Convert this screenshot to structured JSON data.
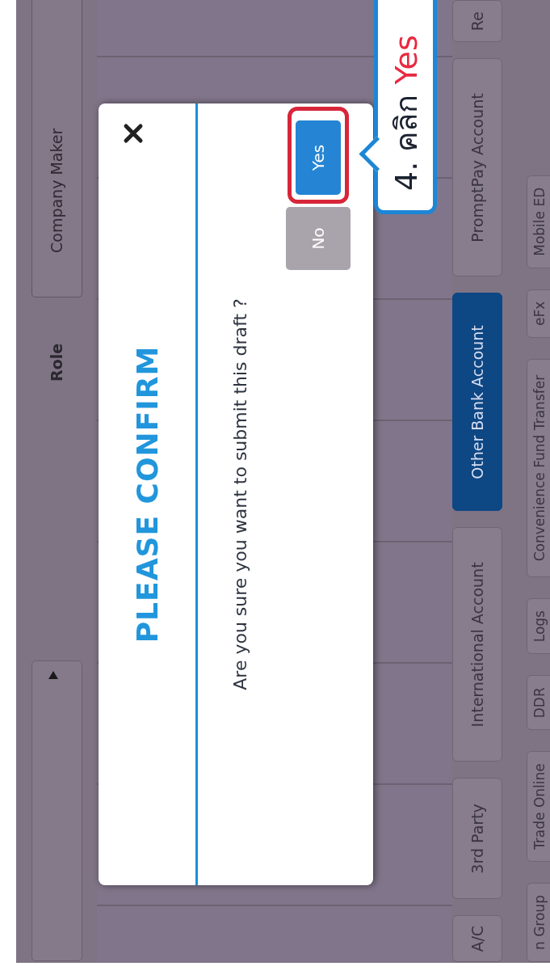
{
  "form": {
    "role_label": "Role",
    "role_value": "Company Maker"
  },
  "tabs_row_1": [
    {
      "label": "A/C",
      "selected": false
    },
    {
      "label": "3rd Party",
      "selected": false
    },
    {
      "label": "International Account",
      "selected": false
    },
    {
      "label": "Other Bank Account",
      "selected": true
    },
    {
      "label": "PromptPay Account",
      "selected": false
    },
    {
      "label": "Re",
      "selected": false
    }
  ],
  "tabs_row_2": [
    {
      "label": "n Group",
      "selected": false
    },
    {
      "label": "Trade Online",
      "selected": false
    },
    {
      "label": "DDR",
      "selected": false
    },
    {
      "label": "Logs",
      "selected": false
    },
    {
      "label": "Convenience Fund Transfer",
      "selected": false
    },
    {
      "label": "eFx",
      "selected": false
    },
    {
      "label": "Mobile ED",
      "selected": false
    }
  ],
  "dialog": {
    "title_part_1": "PLEASE",
    "title_part_2": "CONFIRM",
    "message": "Are you sure you want to submit this draft ?",
    "buttons": [
      {
        "label": "No",
        "kind": "secondary",
        "highlighted": false
      },
      {
        "label": "Yes",
        "kind": "primary",
        "highlighted": true
      }
    ]
  },
  "callout": {
    "step": "4. คลิก",
    "target": "Yes"
  }
}
